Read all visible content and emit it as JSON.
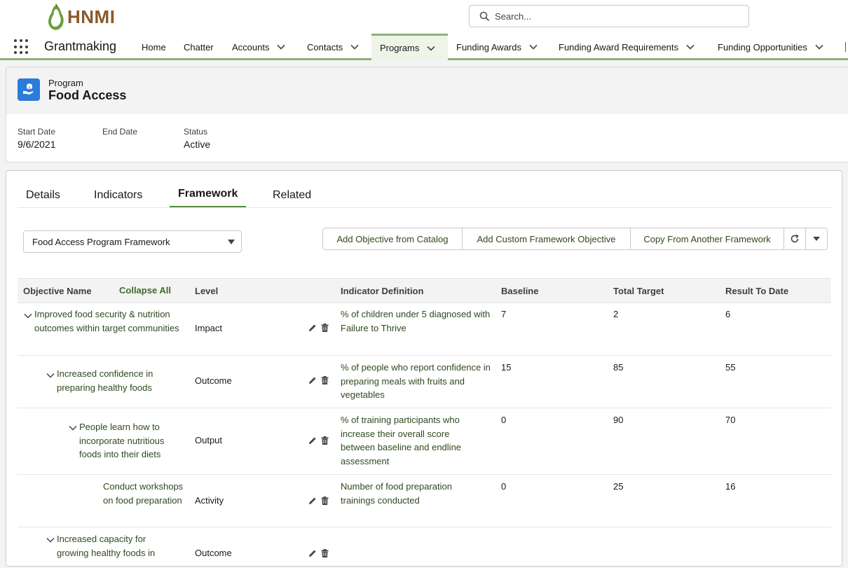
{
  "brand": {
    "logo_text": "HNMI"
  },
  "search": {
    "placeholder": "Search..."
  },
  "nav": {
    "app_name": "Grantmaking",
    "items": [
      {
        "label": "Home"
      },
      {
        "label": "Chatter"
      },
      {
        "label": "Accounts"
      },
      {
        "label": "Contacts"
      },
      {
        "label": "Programs"
      },
      {
        "label": "Funding Awards"
      },
      {
        "label": "Funding Award Requirements"
      },
      {
        "label": "Funding Opportunities"
      }
    ]
  },
  "program": {
    "type_label": "Program",
    "name": "Food Access",
    "fields": [
      {
        "label": "Start Date",
        "value": "9/6/2021"
      },
      {
        "label": "End Date",
        "value": ""
      },
      {
        "label": "Status",
        "value": "Active"
      }
    ]
  },
  "tabs": [
    {
      "label": "Details"
    },
    {
      "label": "Indicators"
    },
    {
      "label": "Framework"
    },
    {
      "label": "Related"
    }
  ],
  "framework": {
    "selected": "Food Access Program Framework",
    "buttons": {
      "add_catalog": "Add Objective from Catalog",
      "add_custom": "Add Custom Framework Objective",
      "copy": "Copy From Another Framework"
    }
  },
  "table": {
    "headers": {
      "objective": "Objective Name",
      "collapse_all": "Collapse All",
      "level": "Level",
      "indicator": "Indicator Definition",
      "baseline": "Baseline",
      "target": "Total Target",
      "result": "Result To Date"
    },
    "rows": [
      {
        "name": "Improved food security & nutrition outcomes within target communities",
        "level": "Impact",
        "indicator": "% of children under 5 diagnosed with Failure to Thrive",
        "baseline": "7",
        "target": "2",
        "result": "6"
      },
      {
        "name": "Increased confidence in preparing healthy foods",
        "level": "Outcome",
        "indicator": "% of people who report confidence in preparing meals with fruits and vegetables",
        "baseline": "15",
        "target": "85",
        "result": "55"
      },
      {
        "name": "People learn how to incorporate nutritious foods into their diets",
        "level": "Output",
        "indicator": "% of training participants who increase their overall score between baseline and endline assessment",
        "baseline": "0",
        "target": "90",
        "result": "70"
      },
      {
        "name": "Conduct workshops on food preparation",
        "level": "Activity",
        "indicator": "Number of food preparation trainings conducted",
        "baseline": "0",
        "target": "25",
        "result": "16"
      },
      {
        "name": "Increased capacity for growing healthy foods in",
        "level": "Outcome",
        "indicator": "",
        "baseline": "",
        "target": "",
        "result": ""
      }
    ]
  },
  "colors": {
    "accent": "#8fb07a",
    "link": "#2e4a1e",
    "icon_blue": "#2b7bd8"
  }
}
